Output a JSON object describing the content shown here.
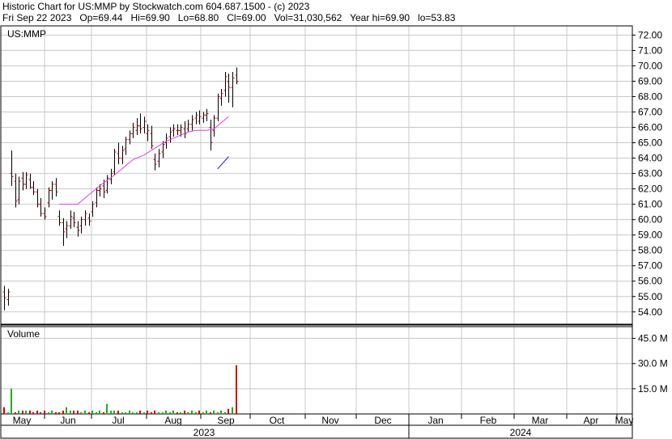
{
  "header": {
    "line1": "Historic Chart for US:MMP by Stockwatch.com 604.687.1500 - (c) 2023",
    "line2": "Fri Sep 22 2023   Op=69.44   Hi=69.90   Lo=68.80   Cl=69.00   Vol=31,030,562   Year hi=69.90   lo=53.83"
  },
  "chart_data": {
    "type": "ohlc",
    "symbol_label": "US:MMP",
    "price_axis": {
      "ticks": [
        "72.00",
        "71.00",
        "70.00",
        "69.00",
        "68.00",
        "67.00",
        "66.00",
        "65.00",
        "64.00",
        "63.00",
        "62.00",
        "61.00",
        "60.00",
        "59.00",
        "58.00",
        "57.00",
        "56.00",
        "55.00",
        "54.00"
      ],
      "range": [
        53.2,
        72.6
      ]
    },
    "volume_axis": {
      "label": "Volume",
      "ticks": [
        "45.0 M",
        "30.0 M",
        "15.0 M"
      ],
      "range": [
        0,
        52
      ]
    },
    "x_axis": {
      "months": [
        "May",
        "Jun",
        "Jul",
        "Aug",
        "Sep",
        "Oct",
        "Nov",
        "Dec",
        "Jan",
        "Feb",
        "Mar",
        "Apr",
        "May"
      ],
      "years": [
        "2023",
        "2024"
      ]
    },
    "series": [
      {
        "name": "price",
        "ohlc": [
          [
            55.3,
            55.7,
            54.1,
            54.9
          ],
          [
            54.8,
            55.5,
            54.4,
            55.3
          ],
          [
            63.0,
            64.5,
            62.2,
            62.8
          ],
          [
            62.5,
            63.0,
            60.8,
            61.2
          ],
          [
            61.3,
            62.8,
            61.0,
            62.5
          ],
          [
            62.7,
            63.1,
            61.9,
            62.3
          ],
          [
            62.3,
            63.1,
            62.0,
            62.9
          ],
          [
            62.6,
            63.0,
            62.0,
            62.1
          ],
          [
            62.1,
            62.5,
            61.6,
            61.8
          ],
          [
            61.8,
            62.0,
            60.8,
            61.0
          ],
          [
            61.0,
            61.4,
            60.2,
            60.4
          ],
          [
            60.4,
            60.8,
            60.0,
            60.2
          ],
          [
            61.1,
            62.1,
            60.8,
            61.9
          ],
          [
            61.9,
            62.5,
            61.3,
            62.3
          ],
          [
            62.3,
            62.7,
            61.5,
            61.8
          ],
          [
            60.2,
            60.6,
            59.6,
            59.8
          ],
          [
            59.8,
            60.1,
            58.3,
            59.2
          ],
          [
            59.4,
            59.9,
            58.8,
            59.6
          ],
          [
            59.6,
            60.6,
            59.4,
            60.2
          ],
          [
            60.1,
            60.5,
            59.5,
            59.8
          ],
          [
            59.5,
            59.9,
            58.9,
            59.3
          ],
          [
            59.6,
            60.2,
            59.1,
            60.0
          ],
          [
            60.0,
            60.6,
            59.6,
            60.4
          ],
          [
            60.1,
            60.4,
            59.6,
            59.9
          ],
          [
            60.5,
            61.2,
            60.2,
            61.0
          ],
          [
            61.1,
            62.1,
            60.8,
            61.9
          ],
          [
            61.9,
            62.3,
            61.5,
            62.0
          ],
          [
            62.2,
            62.6,
            61.4,
            61.8
          ],
          [
            61.9,
            62.9,
            61.7,
            62.7
          ],
          [
            62.6,
            63.3,
            62.3,
            63.0
          ],
          [
            63.1,
            64.6,
            62.9,
            64.4
          ],
          [
            64.3,
            65.0,
            63.6,
            64.0
          ],
          [
            64.0,
            64.8,
            63.6,
            64.5
          ],
          [
            64.6,
            65.4,
            64.2,
            65.2
          ],
          [
            65.2,
            65.8,
            64.9,
            65.6
          ],
          [
            65.6,
            66.3,
            65.3,
            66.0
          ],
          [
            65.8,
            66.6,
            65.5,
            66.1
          ],
          [
            66.1,
            66.9,
            65.6,
            65.9
          ],
          [
            66.0,
            66.7,
            65.6,
            66.4
          ],
          [
            65.6,
            66.2,
            65.1,
            65.8
          ],
          [
            65.6,
            66.1,
            64.6,
            64.8
          ],
          [
            63.9,
            64.3,
            63.2,
            63.6
          ],
          [
            63.8,
            64.6,
            63.4,
            64.3
          ],
          [
            64.4,
            65.1,
            64.0,
            64.9
          ],
          [
            65.0,
            65.6,
            64.6,
            65.3
          ],
          [
            65.4,
            66.0,
            65.0,
            65.7
          ],
          [
            65.8,
            66.2,
            65.4,
            65.9
          ],
          [
            65.8,
            66.2,
            65.5,
            65.8
          ],
          [
            65.8,
            66.2,
            65.4,
            66.0
          ],
          [
            65.9,
            66.4,
            65.3,
            65.6
          ],
          [
            65.9,
            66.5,
            65.7,
            66.2
          ],
          [
            66.2,
            66.8,
            65.8,
            66.5
          ],
          [
            66.6,
            67.0,
            66.2,
            66.8
          ],
          [
            66.4,
            67.1,
            66.2,
            66.7
          ],
          [
            66.6,
            67.0,
            66.3,
            66.8
          ],
          [
            66.8,
            67.2,
            66.4,
            66.9
          ],
          [
            66.0,
            66.5,
            64.5,
            65.0
          ],
          [
            65.8,
            66.8,
            65.4,
            66.6
          ],
          [
            66.6,
            68.2,
            66.4,
            68.0
          ],
          [
            67.9,
            68.5,
            67.4,
            68.2
          ],
          [
            68.4,
            69.6,
            68.0,
            69.3
          ],
          [
            69.0,
            69.5,
            67.6,
            68.6
          ],
          [
            68.6,
            69.6,
            67.3,
            69.2
          ],
          [
            69.4,
            69.9,
            68.8,
            69.0
          ]
        ]
      },
      {
        "name": "moving-average",
        "values": [
          [
            15,
            61.0
          ],
          [
            20,
            61.0
          ],
          [
            21,
            61.2
          ],
          [
            23,
            61.6
          ],
          [
            26,
            62.2
          ],
          [
            30,
            62.9
          ],
          [
            33,
            63.5
          ],
          [
            35,
            63.9
          ],
          [
            38,
            64.2
          ],
          [
            40,
            64.5
          ],
          [
            42,
            64.8
          ],
          [
            44,
            65.1
          ],
          [
            46,
            65.3
          ],
          [
            48,
            65.5
          ],
          [
            50,
            65.7
          ],
          [
            52,
            65.8
          ],
          [
            55,
            65.8
          ],
          [
            57,
            65.9
          ],
          [
            59,
            66.3
          ],
          [
            61,
            66.7
          ]
        ]
      },
      {
        "name": "moving-average-2",
        "values": [
          [
            58,
            63.3
          ],
          [
            61,
            64.1
          ]
        ]
      }
    ],
    "volume": [
      4,
      1,
      15,
      1,
      2,
      2,
      2,
      2,
      1,
      2,
      1,
      2,
      1,
      2,
      1,
      1,
      2,
      4,
      2,
      2,
      2,
      1,
      2,
      1,
      2,
      1,
      2,
      1,
      6,
      2,
      2,
      2,
      1,
      1,
      2,
      1,
      1,
      2,
      1,
      2,
      1,
      2,
      1,
      1,
      2,
      1,
      2,
      1,
      1,
      2,
      1,
      2,
      1,
      2,
      1,
      2,
      1,
      2,
      1,
      2,
      1,
      3,
      4,
      29
    ]
  }
}
